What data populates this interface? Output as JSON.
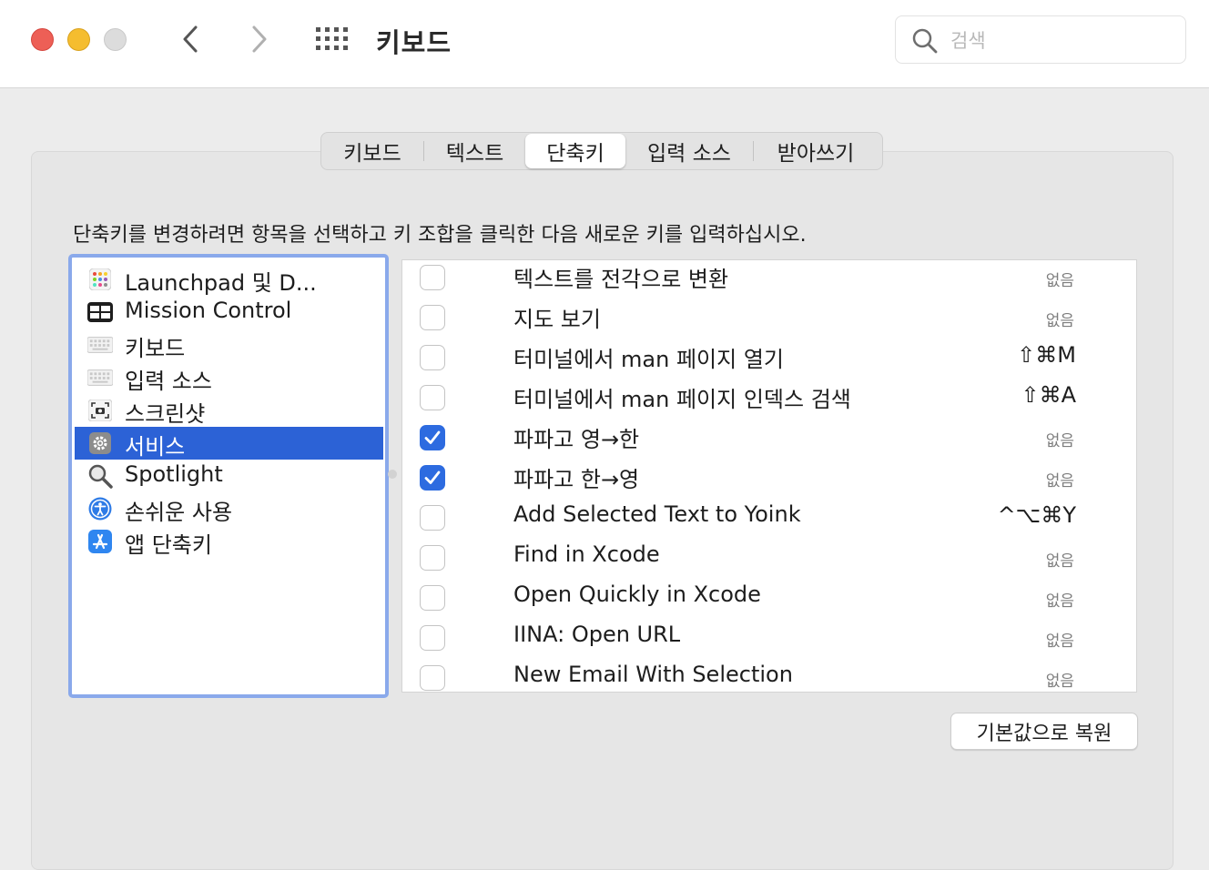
{
  "window": {
    "title": "키보드",
    "search_placeholder": "검색"
  },
  "tabs": [
    {
      "label": "키보드",
      "selected": false
    },
    {
      "label": "텍스트",
      "selected": false
    },
    {
      "label": "단축키",
      "selected": true
    },
    {
      "label": "입력 소스",
      "selected": false
    },
    {
      "label": "받아쓰기",
      "selected": false
    }
  ],
  "instruction": "단축키를 변경하려면 항목을 선택하고 키 조합을 클릭한 다음 새로운 키를 입력하십시오.",
  "categories": [
    {
      "label": "Launchpad 및 D...",
      "icon": "launchpad-icon"
    },
    {
      "label": "Mission Control",
      "icon": "mission-control-icon"
    },
    {
      "label": "키보드",
      "icon": "keyboard-icon"
    },
    {
      "label": "입력 소스",
      "icon": "input-source-icon"
    },
    {
      "label": "스크린샷",
      "icon": "screenshot-icon"
    },
    {
      "label": "서비스",
      "icon": "gear-icon",
      "selected": true
    },
    {
      "label": "Spotlight",
      "icon": "magnifier-icon"
    },
    {
      "label": "손쉬운 사용",
      "icon": "accessibility-icon"
    },
    {
      "label": "앱 단축키",
      "icon": "app-store-icon"
    }
  ],
  "services": [
    {
      "name": "텍스트를 전각으로 변환",
      "checked": false,
      "shortcut": "없음"
    },
    {
      "name": "지도 보기",
      "checked": false,
      "shortcut": "없음"
    },
    {
      "name": "터미널에서 man 페이지 열기",
      "checked": false,
      "shortcut": "⇧⌘M"
    },
    {
      "name": "터미널에서 man 페이지 인덱스 검색",
      "checked": false,
      "shortcut": "⇧⌘A"
    },
    {
      "name": "파파고 영→한",
      "checked": true,
      "shortcut": "없음"
    },
    {
      "name": "파파고 한→영",
      "checked": true,
      "shortcut": "없음"
    },
    {
      "name": "Add Selected Text to Yoink",
      "checked": false,
      "shortcut": "^⌥⌘Y"
    },
    {
      "name": "Find in Xcode",
      "checked": false,
      "shortcut": "없음"
    },
    {
      "name": "Open Quickly in Xcode",
      "checked": false,
      "shortcut": "없음"
    },
    {
      "name": "IINA: Open URL",
      "checked": false,
      "shortcut": "없음"
    },
    {
      "name": "New Email With Selection",
      "checked": false,
      "shortcut": "없음"
    }
  ],
  "restore_button": "기본값으로 복원",
  "colors": {
    "selection": "#2c62d6",
    "checkbox_on": "#2d6be0",
    "list_focus_ring": "#8aa9eb"
  }
}
